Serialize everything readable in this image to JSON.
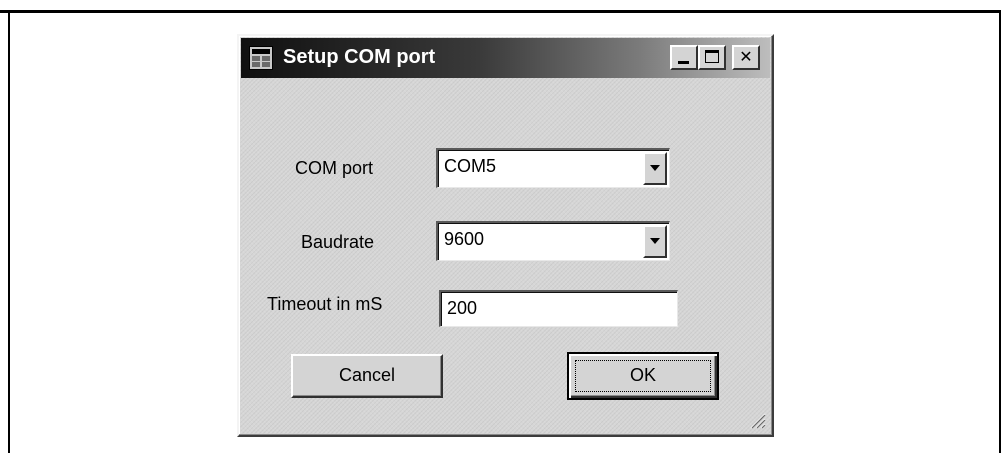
{
  "dialog": {
    "title": "Setup COM port",
    "window_controls": {
      "minimize_icon": "minimize-icon",
      "maximize_icon": "maximize-icon",
      "close_icon": "close-icon",
      "close_glyph": "✕"
    },
    "app_icon": "window-app-icon"
  },
  "form": {
    "com_port_label": "COM port",
    "com_port_value": "COM5",
    "baudrate_label": "Baudrate",
    "baudrate_value": "9600",
    "timeout_label": "Timeout in mS",
    "timeout_value": "200"
  },
  "buttons": {
    "cancel_label": "Cancel",
    "ok_label": "OK"
  },
  "colors": {
    "titlebar_start": "#101010",
    "titlebar_end": "#bdbdbd",
    "dialog_face": "#d6d6d6"
  }
}
